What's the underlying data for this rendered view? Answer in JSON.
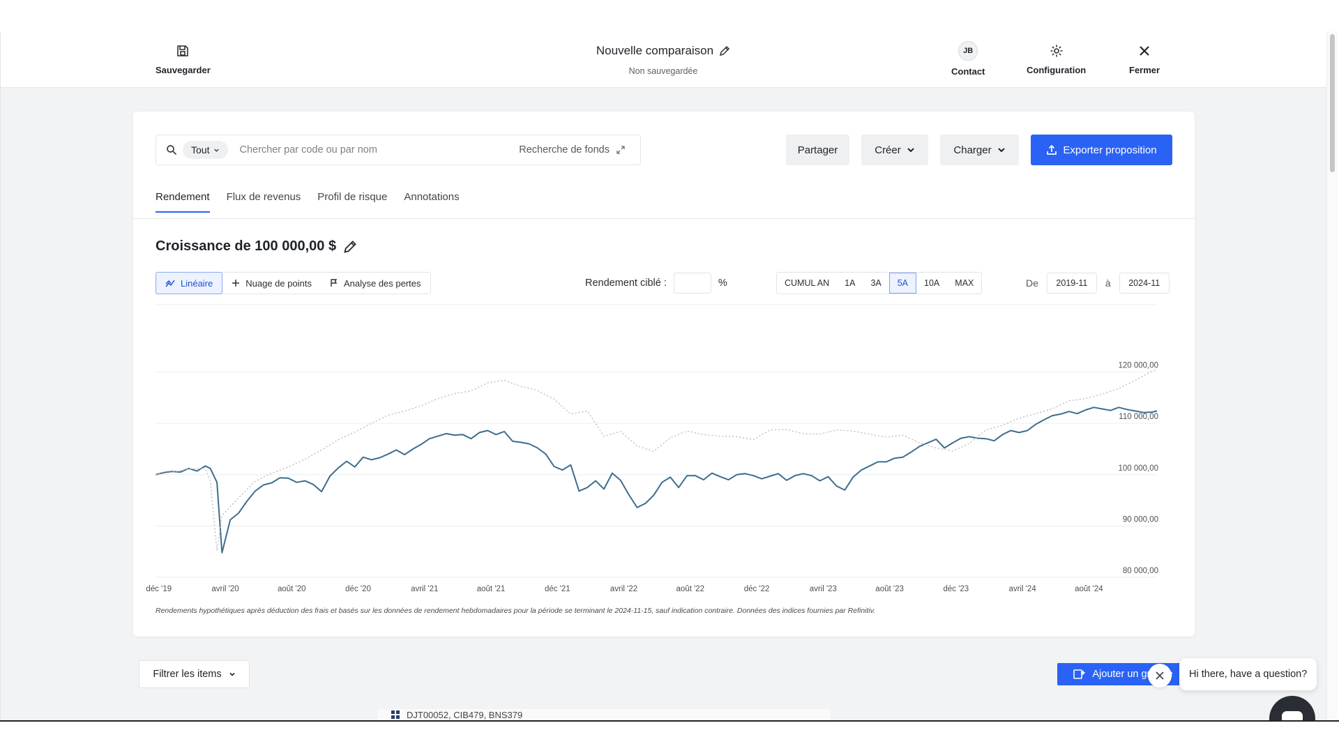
{
  "topbar": {
    "save_label": "Sauvegarder",
    "title": "Nouvelle comparaison",
    "subtitle": "Non sauvegardée",
    "contact_initials": "JB",
    "contact_label": "Contact",
    "config_label": "Configuration",
    "close_label": "Fermer"
  },
  "search": {
    "scope": "Tout",
    "placeholder": "Chercher par code ou par nom",
    "fund_search": "Recherche de fonds"
  },
  "actions": {
    "share": "Partager",
    "create": "Créer",
    "load": "Charger",
    "export": "Exporter proposition"
  },
  "tabs": [
    {
      "label": "Rendement",
      "active": true
    },
    {
      "label": "Flux de revenus",
      "active": false
    },
    {
      "label": "Profil de risque",
      "active": false
    },
    {
      "label": "Annotations",
      "active": false
    }
  ],
  "growth_title": "Croissance de 100 000,00 $",
  "chart_types": [
    {
      "label": "Linéaire",
      "active": true,
      "icon": "line-chart-icon"
    },
    {
      "label": "Nuage de points",
      "active": false,
      "icon": "plus-icon"
    },
    {
      "label": "Analyse des pertes",
      "active": false,
      "icon": "flag-icon"
    }
  ],
  "target_label": "Rendement ciblé :",
  "target_unit": "%",
  "periods": [
    {
      "label": "CUMUL AN",
      "active": false
    },
    {
      "label": "1A",
      "active": false
    },
    {
      "label": "3A",
      "active": false
    },
    {
      "label": "5A",
      "active": true
    },
    {
      "label": "10A",
      "active": false
    },
    {
      "label": "MAX",
      "active": false
    }
  ],
  "range": {
    "from_label": "De",
    "from": "2019-11",
    "to_label": "à",
    "to": "2024-11"
  },
  "chart_data": {
    "type": "line",
    "x_ticks": [
      "déc '19",
      "avril '20",
      "août '20",
      "déc '20",
      "avril '21",
      "août '21",
      "déc '21",
      "avril '22",
      "août '22",
      "déc '22",
      "avril '23",
      "août '23",
      "déc '23",
      "avril '24",
      "août '24"
    ],
    "y_ticks": [
      "80 000,00",
      "90 000,00",
      "100 000,00",
      "110 000,00",
      "120 000,00"
    ],
    "ylim": [
      80000,
      127000
    ],
    "grid": true,
    "series": [
      {
        "style": "solid",
        "color": "#3d6d8c",
        "x": [
          0,
          0.5,
          1,
          1.5,
          2,
          2.5,
          3,
          3.3,
          3.7,
          4,
          4.5,
          5,
          5.5,
          6,
          6.5,
          7,
          7.5,
          8,
          8.5,
          9,
          9.5,
          10,
          10.5,
          11,
          11.5,
          12,
          12.5,
          13,
          13.5,
          14,
          14.5,
          15,
          15.5,
          16,
          16.5,
          17,
          17.5,
          18,
          18.5,
          19,
          19.5,
          20,
          20.5,
          21,
          21.5,
          22,
          22.5,
          23,
          23.5,
          24,
          24.5,
          25,
          25.5,
          26,
          26.5,
          27,
          27.5,
          28,
          28.5,
          29,
          29.5,
          30,
          30.5,
          31,
          31.5,
          32,
          32.5,
          33,
          33.5,
          34,
          34.5,
          35,
          35.5,
          36,
          36.5,
          37,
          37.5,
          38,
          38.5,
          39,
          39.5,
          40,
          40.5,
          41,
          41.5,
          42,
          42.5,
          43,
          43.5,
          44,
          44.5,
          45,
          45.5,
          46,
          46.5,
          47,
          47.5,
          48,
          48.5,
          49,
          49.5,
          50,
          50.5,
          51,
          51.5,
          52,
          52.5,
          53,
          53.5,
          54,
          54.5,
          55,
          55.5,
          56,
          56.5,
          57,
          57.5,
          58,
          58.5,
          59,
          59.5,
          60,
          60.3
        ],
        "y": [
          100000,
          100400,
          100600,
          100500,
          101200,
          100700,
          101700,
          101200,
          98500,
          84800,
          91200,
          92500,
          94800,
          96800,
          98000,
          98400,
          99400,
          99300,
          98500,
          98800,
          98100,
          96700,
          99700,
          101300,
          102600,
          101500,
          103400,
          102900,
          103300,
          104000,
          104800,
          103900,
          105000,
          105900,
          107000,
          107500,
          108000,
          107700,
          107800,
          107000,
          108200,
          108600,
          107800,
          108400,
          106500,
          106300,
          106000,
          105200,
          104000,
          101600,
          100900,
          101900,
          96800,
          97500,
          98800,
          97200,
          100300,
          98900,
          96100,
          93600,
          94400,
          96000,
          98500,
          99500,
          97500,
          99800,
          99800,
          99000,
          100300,
          99600,
          99000,
          100000,
          100200,
          99800,
          99200,
          99700,
          100200,
          98900,
          99800,
          100200,
          99800,
          98800,
          99600,
          97800,
          97000,
          99500,
          100900,
          101700,
          102500,
          102500,
          103200,
          103400,
          104400,
          105500,
          106200,
          106900,
          105200,
          106200,
          107100,
          107400,
          107100,
          107000,
          106600,
          107800,
          108600,
          108200,
          108600,
          109800,
          110700,
          111500,
          111800,
          112300,
          111900,
          112600,
          113100,
          112800,
          112500,
          113100,
          112700,
          112400,
          112100,
          112200,
          112400
        ]
      },
      {
        "style": "dotted",
        "color": "#b9bec4",
        "x": [
          0,
          1,
          2,
          3,
          3.3,
          3.7,
          4,
          5,
          6,
          7,
          8,
          9,
          10,
          11,
          12,
          13,
          14,
          15,
          16,
          17,
          18,
          19,
          20,
          21,
          22,
          23,
          24,
          25,
          26,
          27,
          28,
          29,
          30,
          31,
          32,
          33,
          34,
          35,
          36,
          37,
          38,
          39,
          40,
          41,
          42,
          43,
          44,
          45,
          46,
          47,
          48,
          49,
          50,
          51,
          52,
          53,
          54,
          55,
          56,
          57,
          58,
          59,
          60,
          60.3
        ],
        "y": [
          100000,
          100500,
          101100,
          101300,
          98700,
          85200,
          92000,
          95500,
          98700,
          100300,
          101500,
          103000,
          104800,
          106800,
          108300,
          110000,
          111600,
          112400,
          113400,
          114800,
          115800,
          116300,
          117900,
          118400,
          117200,
          116400,
          114700,
          111800,
          112400,
          107500,
          108400,
          105600,
          104500,
          107200,
          108500,
          107800,
          107500,
          107400,
          106800,
          108700,
          108800,
          108000,
          107900,
          108700,
          108500,
          107900,
          107300,
          107700,
          106200,
          105200,
          104600,
          106100,
          108700,
          109600,
          111000,
          111900,
          112800,
          114400,
          114800,
          115700,
          116800,
          118400,
          120200,
          120500
        ]
      }
    ]
  },
  "footnote": "Rendements hypothétiques après déduction des frais et basés sur les données de rendement hebdomadaires pour la période se terminant le 2024-11-15, sauf indication contraire. Données des indices fournies par Refinitiv.",
  "filter_label": "Filtrer les items",
  "add_group_label": "Ajouter un groupe",
  "list_item_peek": "DJT00052, CIB479, BNS379",
  "chat": {
    "message": "Hi there, have a question?"
  },
  "colors": {
    "accent": "#2962f5",
    "line": "#3d6d8c"
  }
}
